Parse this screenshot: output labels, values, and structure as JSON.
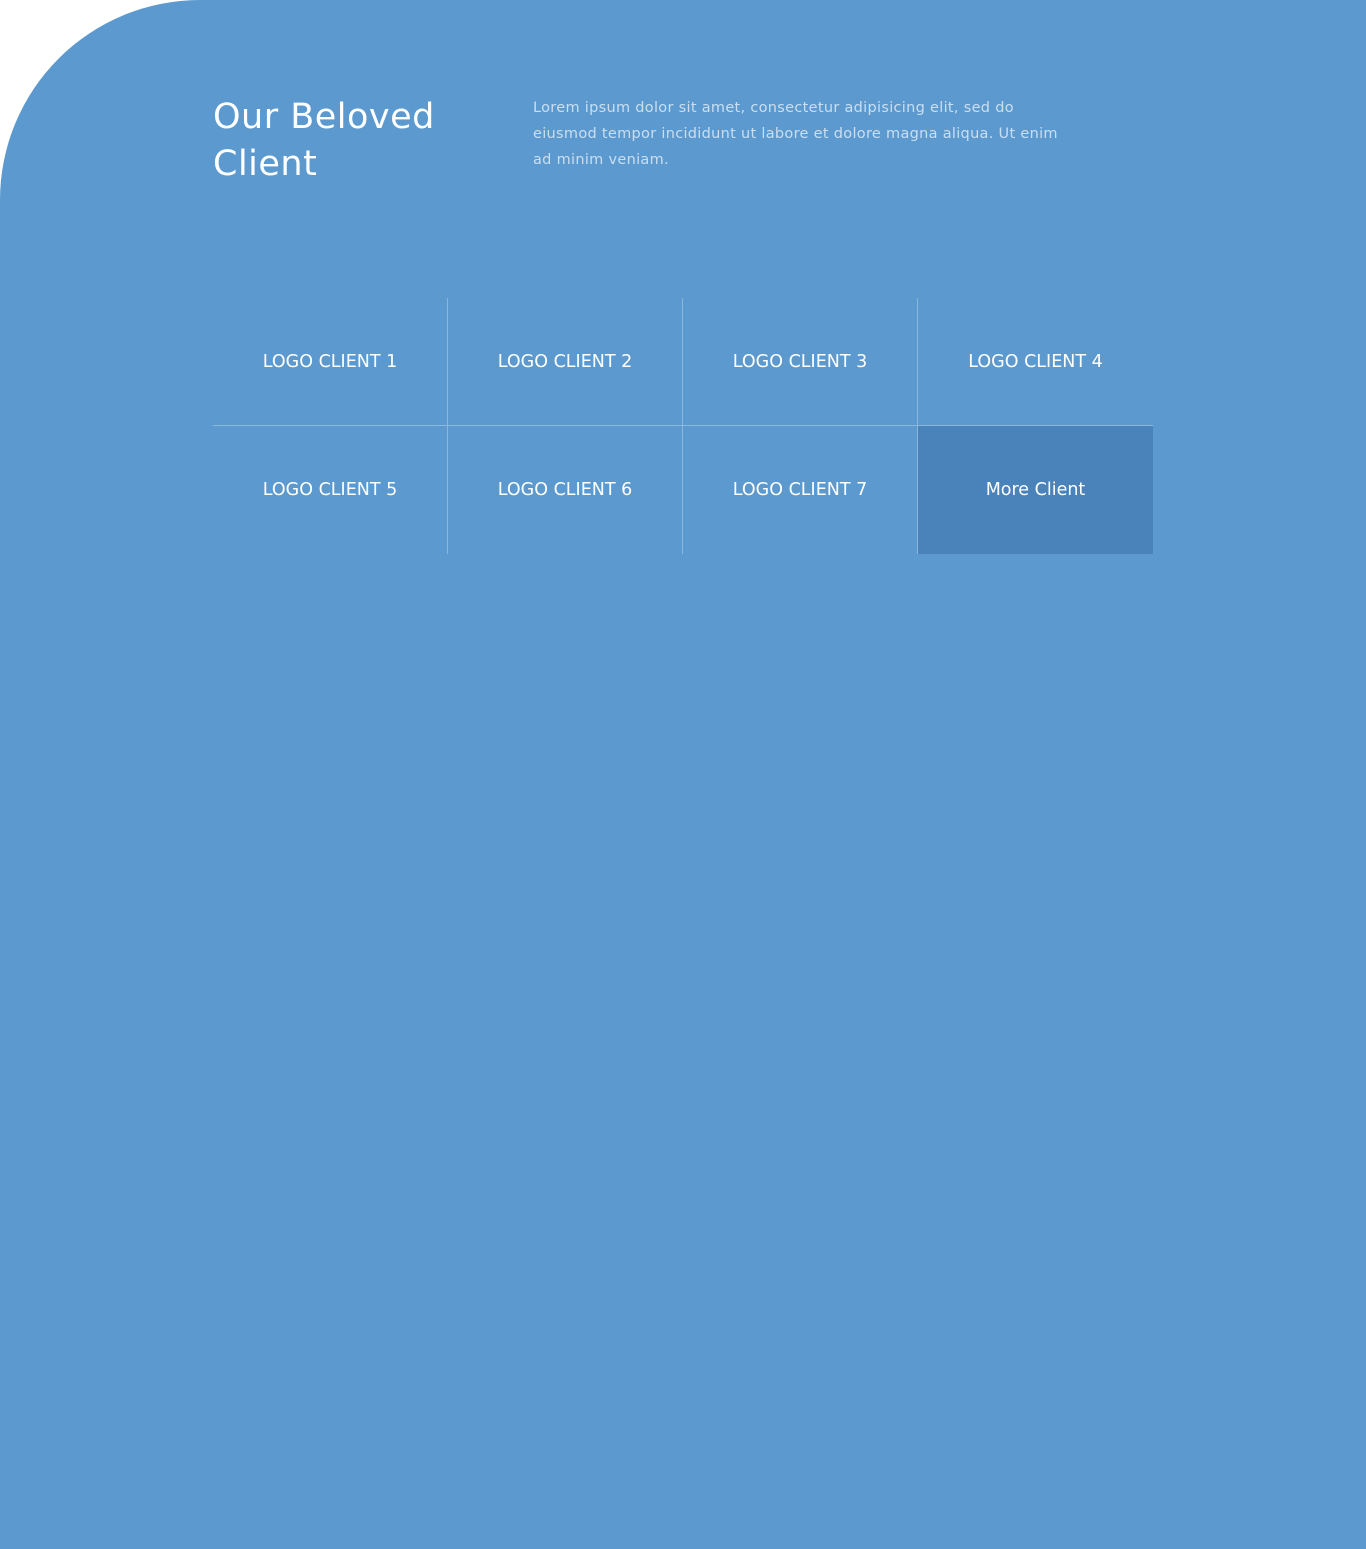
{
  "colors": {
    "section_background": "#5b99cf",
    "more_button_background": "#4a83ba",
    "text": "#ffffff"
  },
  "clients": {
    "title": "Our Beloved Client",
    "description": "Lorem ipsum dolor sit amet, consectetur adipisicing elit, sed do eiusmod tempor incididunt ut labore et dolore magna aliqua. Ut enim ad minim veniam.",
    "logos": [
      "LOGO CLIENT 1",
      "LOGO CLIENT 2",
      "LOGO CLIENT 3",
      "LOGO CLIENT 4",
      "LOGO CLIENT 5",
      "LOGO CLIENT 6",
      "LOGO CLIENT 7"
    ],
    "more_label": "More Client"
  }
}
